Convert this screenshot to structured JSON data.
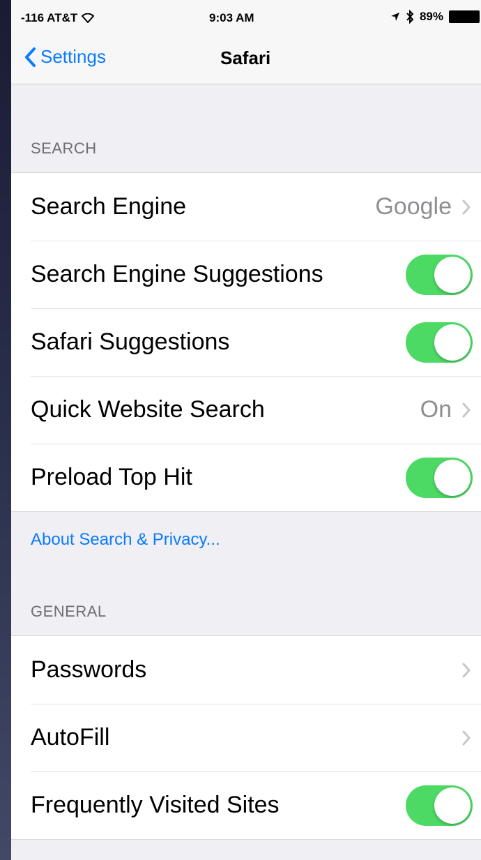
{
  "status_bar": {
    "carrier": "-116 AT&T",
    "time": "9:03 AM",
    "battery": "89%",
    "icons": [
      "wifi-icon",
      "location-icon",
      "bluetooth-icon",
      "battery-icon"
    ]
  },
  "nav": {
    "back_label": "Settings",
    "title": "Safari"
  },
  "search_section": {
    "header": "SEARCH",
    "rows": [
      {
        "label": "Search Engine",
        "value": "Google",
        "type": "disclosure"
      },
      {
        "label": "Search Engine Suggestions",
        "type": "toggle",
        "on": true
      },
      {
        "label": "Safari Suggestions",
        "type": "toggle",
        "on": true
      },
      {
        "label": "Quick Website Search",
        "value": "On",
        "type": "disclosure"
      },
      {
        "label": "Preload Top Hit",
        "type": "toggle",
        "on": true
      }
    ],
    "footer_link": "About Search & Privacy..."
  },
  "general_section": {
    "header": "GENERAL",
    "rows": [
      {
        "label": "Passwords",
        "type": "disclosure"
      },
      {
        "label": "AutoFill",
        "type": "disclosure"
      },
      {
        "label": "Frequently Visited Sites",
        "type": "toggle",
        "on": true
      }
    ]
  },
  "colors": {
    "accent": "#0a7aff",
    "toggle_on": "#4cd964",
    "background": "#efeff4"
  }
}
